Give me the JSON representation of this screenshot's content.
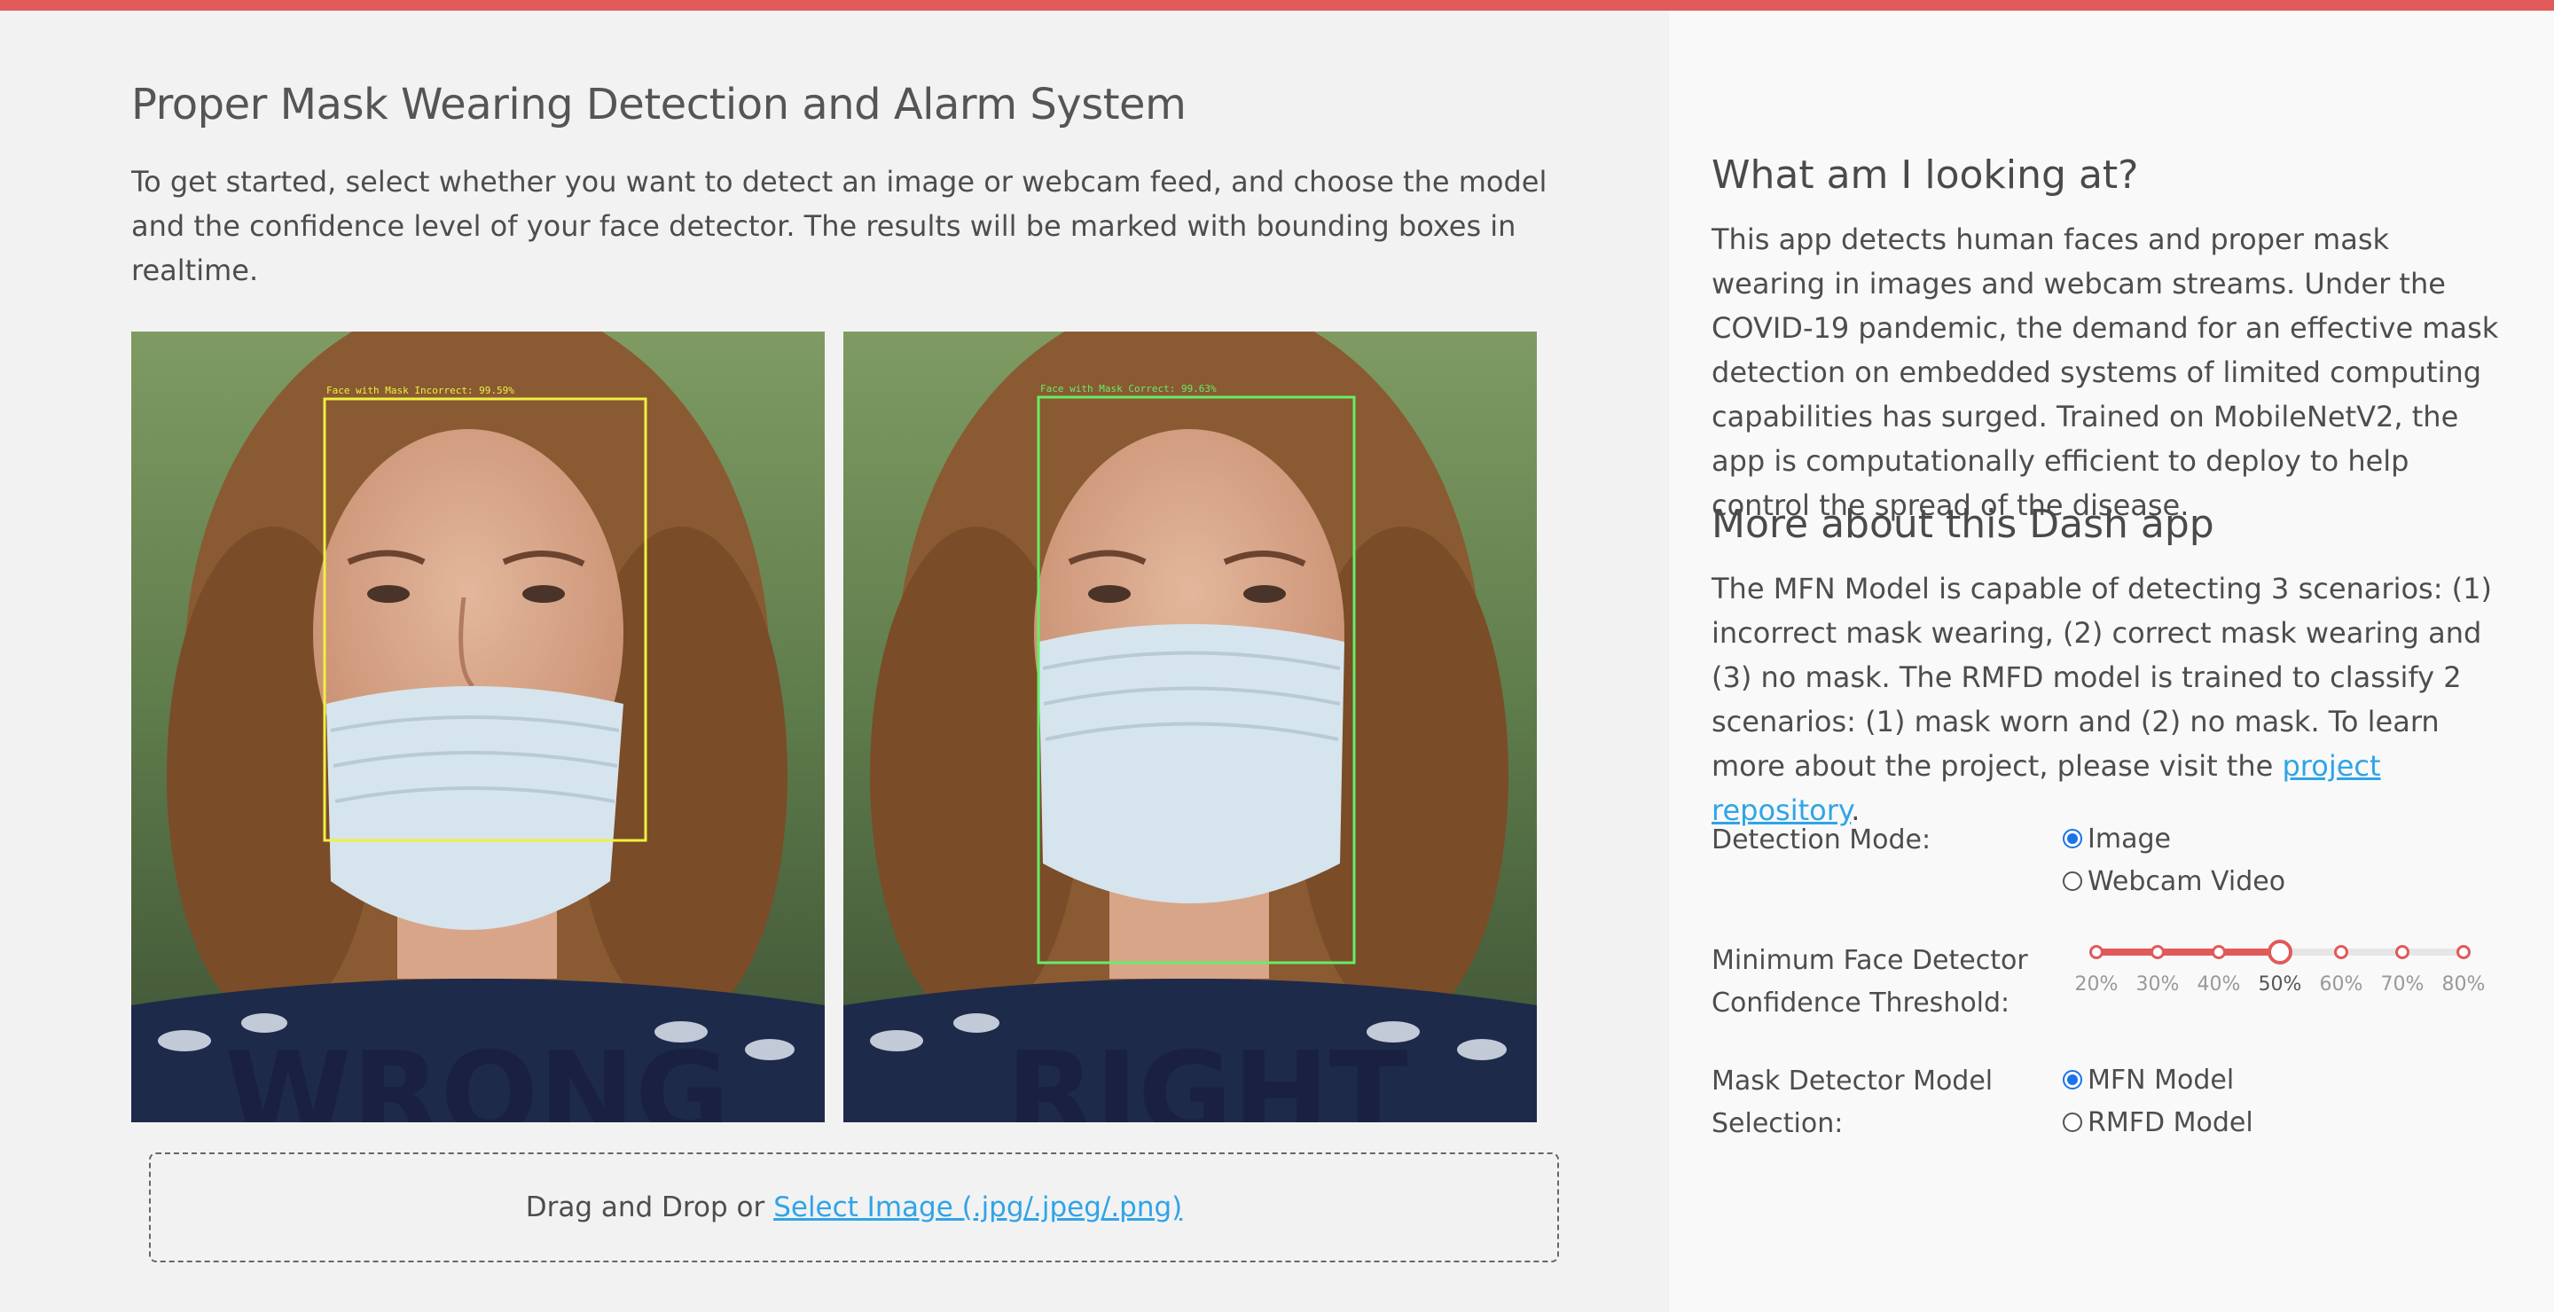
{
  "page": {
    "title": "Proper Mask Wearing Detection and Alarm System",
    "intro": "To get started, select whether you want to detect an image or webcam feed, and choose the model and the confidence level of your face detector. The results will be marked with bounding boxes in realtime."
  },
  "images": {
    "left": {
      "box_label": "Face with Mask Incorrect: 99.59%",
      "caption": "WRONG",
      "box_color": "#f0f040"
    },
    "right": {
      "box_label": "Face with Mask Correct: 99.63%",
      "caption": "RIGHT",
      "box_color": "#66ee66"
    }
  },
  "upload": {
    "prefix": "Drag and Drop or",
    "link": "Select Image (.jpg/.jpeg/.png)"
  },
  "sidebar": {
    "heading1": "What am I looking at?",
    "para1": "This app detects human faces and proper mask wearing in images and webcam streams. Under the COVID-19 pandemic, the demand for an effective mask detection on embedded systems of limited computing capabilities has surged. Trained on MobileNetV2, the app is computationally efficient to deploy to help control the spread of the disease.",
    "heading2": "More about this Dash app",
    "para2_text": "The MFN Model is capable of detecting 3 scenarios: (1) incorrect mask wearing, (2) correct mask wearing and (3) no mask. The RMFD model is trained to classify 2 scenarios: (1) mask worn and (2) no mask. To learn more about the project, please visit the",
    "para2_link": "project repository",
    "para2_end": "."
  },
  "controls": {
    "detection_mode": {
      "label": "Detection Mode:",
      "options": [
        "Image",
        "Webcam Video"
      ],
      "selected": "Image"
    },
    "threshold": {
      "label_line1": "Minimum Face Detector",
      "label_line2": "Confidence Threshold:",
      "marks": [
        "20%",
        "30%",
        "40%",
        "50%",
        "60%",
        "70%",
        "80%"
      ],
      "value": "50%",
      "accent": "#e05a5a"
    },
    "model": {
      "label_line1": "Mask Detector Model",
      "label_line2": "Selection:",
      "options": [
        "MFN Model",
        "RMFD Model"
      ],
      "selected": "MFN Model"
    }
  },
  "colors": {
    "accent": "#e05a5a",
    "link": "#2fa4e7",
    "radio": "#1a73e8"
  }
}
